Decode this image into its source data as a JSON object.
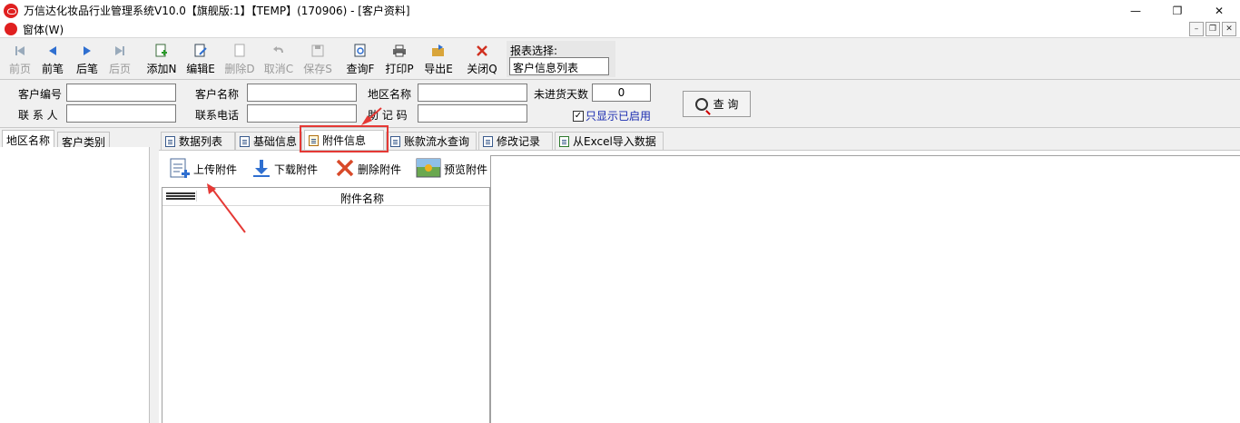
{
  "window": {
    "title": "万信达化妆品行业管理系统V10.0【旗舰版:1】【TEMP】(170906) - [客户资料]",
    "minimize": "—",
    "maximize": "❐",
    "close": "✕"
  },
  "menu": {
    "item": "窗体(W)",
    "mdi_min": "–",
    "mdi_restore": "❐",
    "mdi_close": "✕"
  },
  "toolbar": {
    "prev_page": "前页",
    "prev": "前笔",
    "next": "后笔",
    "next_page": "后页",
    "add": "添加N",
    "edit": "编辑E",
    "delete": "删除D",
    "cancel": "取消C",
    "save": "保存S",
    "query": "查询F",
    "print": "打印P",
    "export": "导出E",
    "close": "关闭Q",
    "report_label": "报表选择:",
    "report_value": "客户信息列表"
  },
  "filter": {
    "customer_no_label": "客户编号",
    "customer_no_value": "",
    "customer_name_label": "客户名称",
    "customer_name_value": "",
    "region_label": "地区名称",
    "region_value": "",
    "no_purchase_label": "未进货天数",
    "no_purchase_value": "0",
    "contact_label": "联 系 人",
    "contact_value": "",
    "phone_label": "联系电话",
    "phone_value": "",
    "mnemonic_label": "助 记 码",
    "mnemonic_value": "",
    "only_enabled_label": "只显示已启用",
    "only_enabled_checked": "✓",
    "query_button": "查 询"
  },
  "left_tabs": {
    "region": "地区名称",
    "category": "客户类别"
  },
  "tabs": {
    "data_list": "数据列表",
    "basic_info": "基础信息",
    "attachment": "附件信息",
    "ledger": "账款流水查询",
    "modify_log": "修改记录",
    "excel_import": "从Excel导入数据"
  },
  "attachment": {
    "upload": "上传附件",
    "download": "下载附件",
    "delete": "删除附件",
    "preview": "预览附件",
    "column_name": "附件名称"
  }
}
